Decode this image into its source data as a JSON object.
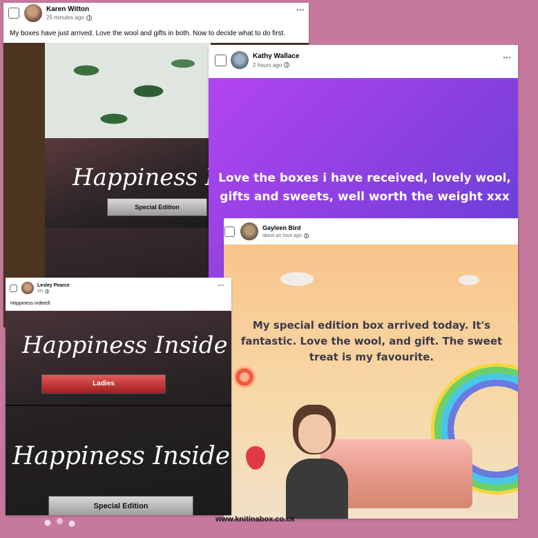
{
  "posts": [
    {
      "name": "Karen Witton",
      "time": "25 minutes ago",
      "text": "My boxes have just arrived. Love the wool and gifts in both. Now to decide what to do first."
    },
    {
      "name": "Kathy Wallace",
      "time": "2 hours ago",
      "text": "Love the boxes i have received, lovely wool, gifts and sweets, well worth the weight xxx"
    },
    {
      "name": "Gayleen Bird",
      "time": "about an hour ago",
      "text": "My special edition box arrived today. It's fantastic. Love the wool, and gift. The sweet treat is my favourite."
    },
    {
      "name": "Lesley Pearce",
      "time": "2m",
      "text": "Happiness indeed!"
    }
  ],
  "photo_text": {
    "script1": "Happiness Inside",
    "script2": "Happiness Inside",
    "script_partial": "Happiness Insi",
    "sign_special": "Special Edition",
    "sign_ladies": "Ladies"
  },
  "menu_glyph": "•••",
  "footer_url": "www.knitinabox.co.uk",
  "colors": {
    "background": "#c5799c",
    "kathy_gradient_start": "#a545ef",
    "kathy_gradient_end": "#6a3fd8",
    "gayleen_bg": "#f6c48d"
  }
}
